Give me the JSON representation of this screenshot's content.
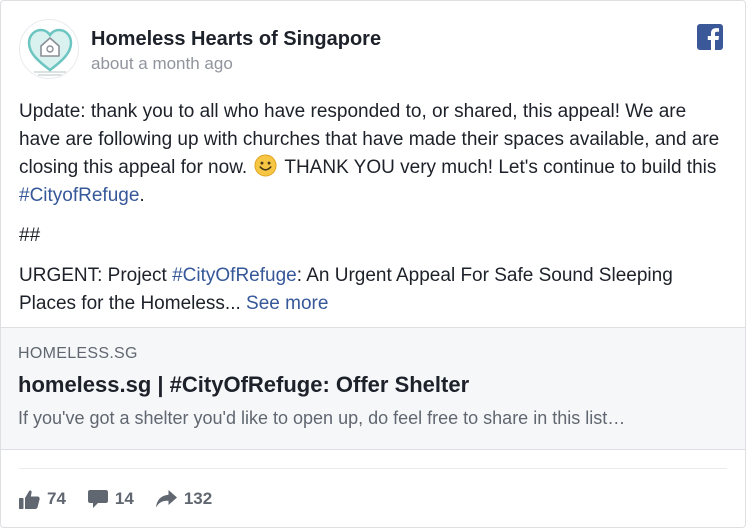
{
  "post": {
    "page_name": "Homeless Hearts of Singapore",
    "timestamp": "about a month ago",
    "body": {
      "p1_a": "Update: thank you to all who have responded to, or shared, this appeal! We are have are following up with churches that have made their spaces available, and are closing this appeal for now. ",
      "p1_b": " THANK YOU very much! Let's continue to build this ",
      "p1_hashtag": "#CityofRefuge",
      "p1_end": ".",
      "p2": "##",
      "p3_a": "URGENT: Project ",
      "p3_hashtag": "#CityOfRefuge",
      "p3_b": ": An Urgent Appeal For Safe Sound Sleeping Places for the Homeless... ",
      "see_more": "See more"
    },
    "link": {
      "domain": "HOMELESS.SG",
      "title": "homeless.sg | #CityOfRefuge: Offer Shelter",
      "description": "If you've got a shelter you'd like to open up, do feel free to share in this list…"
    },
    "stats": {
      "likes": "74",
      "comments": "14",
      "shares": "132"
    }
  },
  "colors": {
    "brand": "#3b5998",
    "link": "#365899",
    "secondary_text": "#90949c",
    "avatar_accent": "#6cc5c0"
  },
  "icons": [
    "facebook-logo-icon",
    "smile-emoji-icon",
    "like-icon",
    "comment-icon",
    "share-icon"
  ]
}
